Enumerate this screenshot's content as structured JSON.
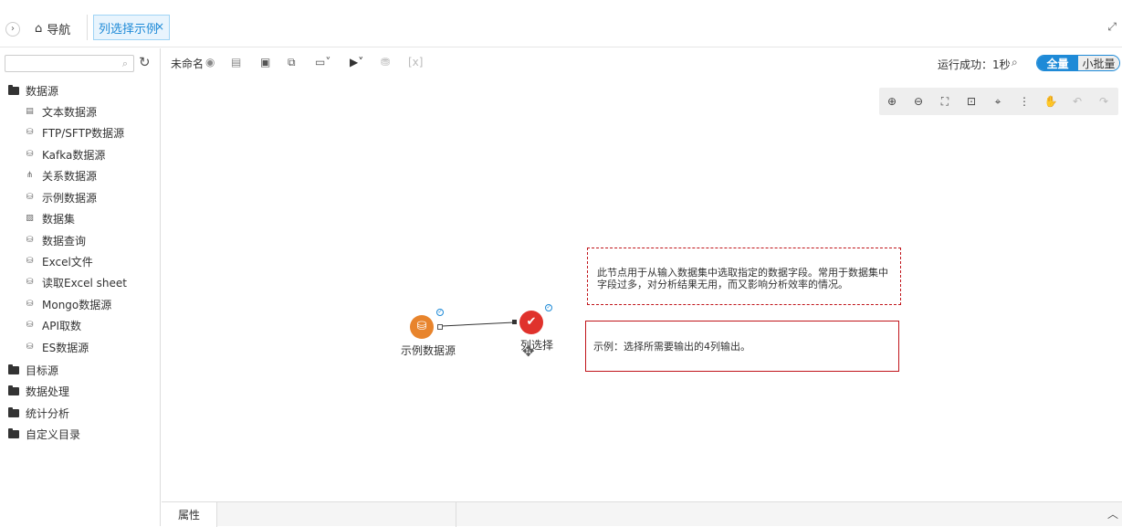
{
  "topbar": {
    "nav_label": "导航",
    "active_tab_label": "列选择示例",
    "close_symbol": "×"
  },
  "sidebar": {
    "search_placeholder": "",
    "tree": [
      {
        "label": "数据源",
        "type": "folder",
        "expanded": true,
        "children": [
          {
            "label": "文本数据源",
            "icon": "txt-file-icon"
          },
          {
            "label": "FTP/SFTP数据源",
            "icon": "db-link-icon"
          },
          {
            "label": "Kafka数据源",
            "icon": "db-link-icon"
          },
          {
            "label": "关系数据源",
            "icon": "relation-icon"
          },
          {
            "label": "示例数据源",
            "icon": "db-link-icon"
          },
          {
            "label": "数据集",
            "icon": "dataset-icon"
          },
          {
            "label": "数据查询",
            "icon": "db-link-icon"
          },
          {
            "label": "Excel文件",
            "icon": "db-link-icon"
          },
          {
            "label": "读取Excel sheet",
            "icon": "db-link-icon"
          },
          {
            "label": "Mongo数据源",
            "icon": "db-link-icon"
          },
          {
            "label": "API取数",
            "icon": "db-link-icon"
          },
          {
            "label": "ES数据源",
            "icon": "db-link-icon"
          }
        ]
      },
      {
        "label": "目标源",
        "type": "folder"
      },
      {
        "label": "数据处理",
        "type": "folder"
      },
      {
        "label": "统计分析",
        "type": "folder"
      },
      {
        "label": "自定义目录",
        "type": "folder"
      }
    ]
  },
  "toolbar": {
    "doc_name": "未命名",
    "status_text": "运行成功：1秒",
    "mode_full": "全量",
    "mode_batch": "小批量"
  },
  "canvas": {
    "node1_label": "示例数据源",
    "node2_label": "列选择",
    "note1_text": "此节点用于从输入数据集中选取指定的数据字段。常用于数据集中字段过多，对分析结果无用，而又影响分析效率的情况。",
    "note2_text": "示例：选择所需要输出的4列输出。",
    "node1_color": "#e8842c",
    "node2_color": "#e0322c"
  },
  "bottom": {
    "properties_tab": "属性"
  },
  "colors": {
    "accent": "#1e8ad7",
    "note_border": "#c0141a"
  }
}
